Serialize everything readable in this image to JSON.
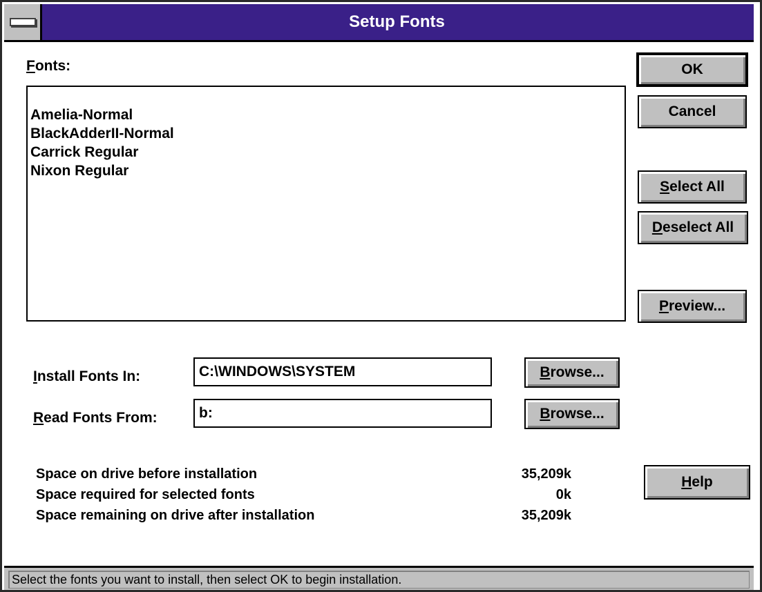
{
  "window": {
    "title": "Setup Fonts"
  },
  "fonts_section": {
    "label_mnemonic": "F",
    "label_rest": "onts:",
    "items": [
      "Amelia-Normal",
      "BlackAdderII-Normal",
      "Carrick Regular",
      "Nixon Regular"
    ]
  },
  "buttons": {
    "ok": "OK",
    "cancel": "Cancel",
    "select_all_mnemonic": "S",
    "select_all_rest": "elect All",
    "deselect_all_mnemonic": "D",
    "deselect_all_rest": "eselect All",
    "preview_mnemonic": "P",
    "preview_rest": "review...",
    "browse_mnemonic": "B",
    "browse_rest": "rowse...",
    "help_mnemonic": "H",
    "help_rest": "elp"
  },
  "install_in": {
    "label_mnemonic": "I",
    "label_rest": "nstall Fonts In:",
    "value": "C:\\WINDOWS\\SYSTEM"
  },
  "read_from": {
    "label_mnemonic": "R",
    "label_rest": "ead Fonts From:",
    "value": "b:"
  },
  "space_info": [
    {
      "label": "Space on drive before installation",
      "value": "35,209k"
    },
    {
      "label": "Space required for selected fonts",
      "value": "0k"
    },
    {
      "label": "Space remaining on drive after installation",
      "value": "35,209k"
    }
  ],
  "status": "Select the fonts you want to install, then select OK to begin installation.",
  "colors": {
    "titlebar": "#3a2088",
    "button_face": "#c0c0c0"
  }
}
